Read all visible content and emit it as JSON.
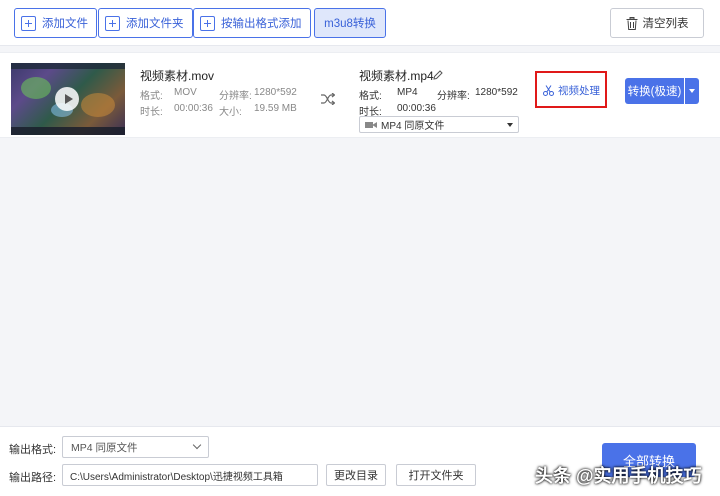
{
  "toolbar": {
    "add_file": "添加文件",
    "add_folder": "添加文件夹",
    "add_by_format": "按输出格式添加",
    "m3u8": "m3u8转换",
    "clear_list": "清空列表"
  },
  "file": {
    "source": {
      "name": "视频素材.mov",
      "format_label": "格式:",
      "format": "MOV",
      "resolution_label": "分辨率:",
      "resolution": "1280*592",
      "duration_label": "时长:",
      "duration": "00:00:36",
      "size_label": "大小:",
      "size": "19.59 MB"
    },
    "output": {
      "name": "视频素材.mp4",
      "format_label": "格式:",
      "format": "MP4",
      "resolution_label": "分辨率:",
      "resolution": "1280*592",
      "duration_label": "时长:",
      "duration": "00:00:36",
      "format_select": "MP4  同原文件"
    },
    "video_process": "视频处理",
    "convert": "转换(极速)"
  },
  "bottom": {
    "output_format_label": "输出格式:",
    "output_format_value": "MP4  同原文件",
    "output_path_label": "输出路径:",
    "output_path_value": "C:\\Users\\Administrator\\Desktop\\迅捷视频工具箱",
    "change_dir": "更改目录",
    "open_folder": "打开文件夹",
    "convert_all": "全部转换"
  },
  "watermark": "头条 @实用手机技巧",
  "colors": {
    "accent": "#4a72e8",
    "highlight_border": "#e01919"
  }
}
